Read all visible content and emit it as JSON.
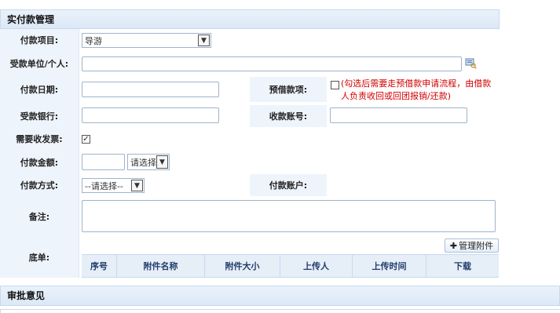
{
  "section1": {
    "title": "实付款管理"
  },
  "fields": {
    "item_label": "付款项目:",
    "item_value": "导游",
    "payee_label": "受款单位/个人:",
    "date_label": "付款日期:",
    "advance_label": "预借款项:",
    "advance_note": "(勾选后需要走预借款申请流程，由借款人负责收回或回团报销/还款)",
    "bank_label": "受款银行:",
    "account_label": "收款账号:",
    "invoice_label": "需要收发票:",
    "amount_label": "付款金额:",
    "currency_value": "请选择",
    "method_label": "付款方式:",
    "method_value": "--请选择--",
    "payer_account_label": "付款账户:",
    "remark_label": "备注:",
    "attach_label": "底单:"
  },
  "attachments": {
    "manage_button": "管理附件",
    "columns": [
      "序号",
      "附件名称",
      "附件大小",
      "上传人",
      "上传时间",
      "下载"
    ]
  },
  "section2": {
    "title": "审批意见"
  },
  "colors": {
    "header_bg": "#dce8f6",
    "label_bg": "#eef4fb",
    "border": "#9fb4cc",
    "note_red": "#d20000"
  }
}
